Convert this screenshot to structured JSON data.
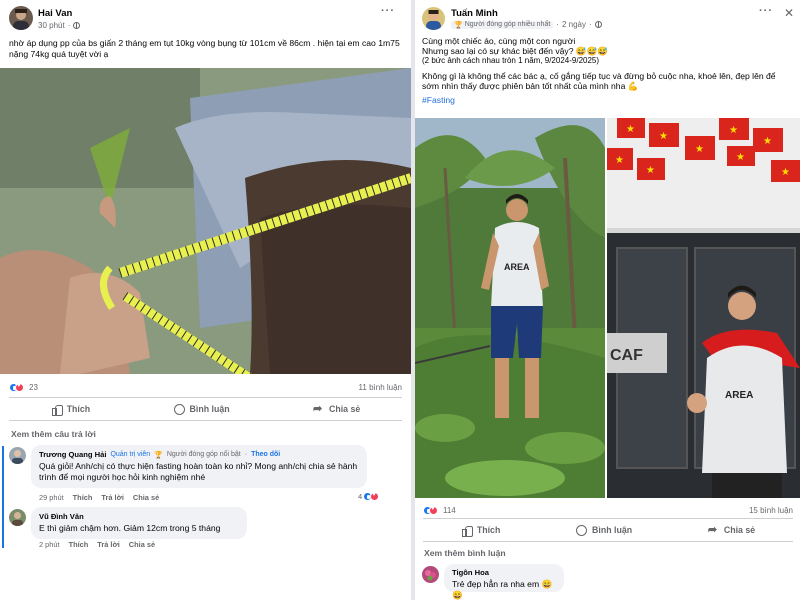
{
  "left_post": {
    "author": "Hai Van",
    "time": "30 phút",
    "text": "nhờ áp dụng pp của bs giấn 2 tháng em tụt 10kg vòng bụng từ 101cm về 86cm . hiện tại em cao 1m75 nặng 74kg quá tuyệt vời ạ",
    "reaction_count": "23",
    "comment_count": "11 bình luận",
    "actions": {
      "like": "Thích",
      "comment": "Bình luận",
      "share": "Chia sẻ"
    },
    "see_more": "Xem thêm câu trả lời",
    "comments": [
      {
        "author": "Trương Quang Hải",
        "badge_admin": "Quản trị viên",
        "badge_contributor": "Người đóng góp nổi bật",
        "follow": "Theo dõi",
        "text": "Quá giỏi! Anh/chị có thực hiện fasting hoàn toàn ko nhỉ? Mong anh/chị chia sẻ hành trình để mọi người học hỏi kinh nghiệm nhé",
        "time": "29 phút",
        "like": "Thích",
        "reply": "Trả lời",
        "share": "Chia sẻ",
        "reactions": "4"
      },
      {
        "author": "Vũ Đình Văn",
        "text": "E thì giảm chậm hơn. Giảm 12cm trong 5 tháng",
        "time": "2 phút",
        "like": "Thích",
        "reply": "Trả lời",
        "share": "Chia sẻ"
      }
    ]
  },
  "right_post": {
    "author": "Tuấn Minh",
    "badge": "Người đóng góp nhiều nhất",
    "time": "2 ngày",
    "lines": [
      "Cùng một chiếc áo, cùng một con người",
      "Nhưng sao lại có sự khác biệt đến vậy? 😅😅😅",
      "(2 bức ảnh cách nhau tròn 1 năm, 9/2024-9/2025)"
    ],
    "paragraph": "Không gì là không thể các bác ạ, cố gắng tiếp tục và đừng bỏ cuộc nha, khoẻ lên, đẹp lên để sớm nhìn thấy được phiên bản tốt nhất của mình nha 💪",
    "hashtag": "#Fasting",
    "photo_texts": {
      "shirt_print": "AREA",
      "shop_sign": "CAF"
    },
    "reaction_count": "114",
    "comment_count": "15 bình luận",
    "actions": {
      "like": "Thích",
      "comment": "Bình luận",
      "share": "Chia sẻ"
    },
    "see_more": "Xem thêm bình luận",
    "comment": {
      "author": "Tigôn Hoa",
      "text": "Trẻ đẹp hẳn ra nha em 😄😄"
    }
  },
  "colors": {
    "accent": "#1877f2",
    "love": "#f33e58",
    "secondary_text": "#65676b",
    "bubble": "#f0f2f5"
  }
}
